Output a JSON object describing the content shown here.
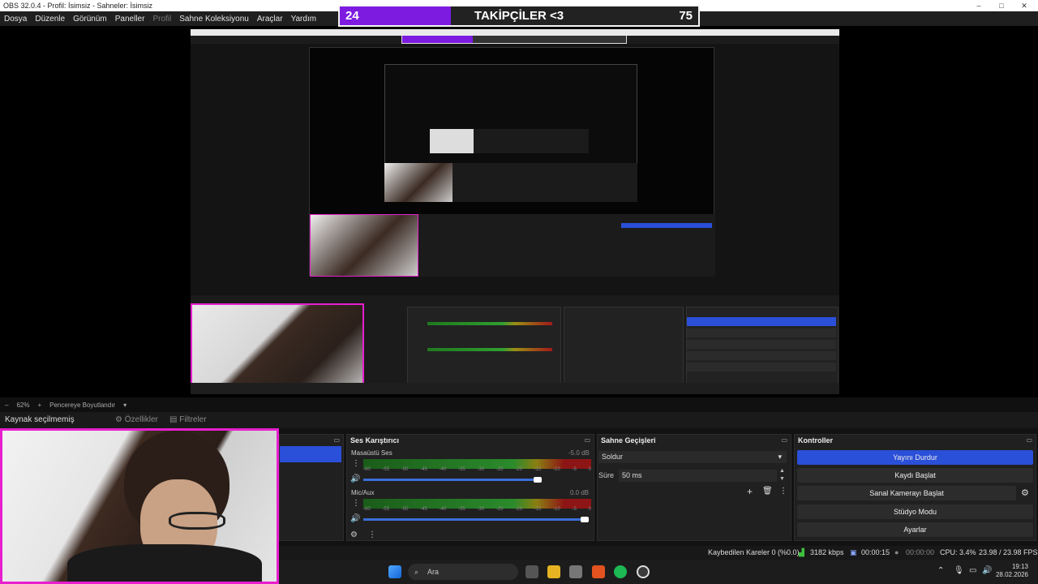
{
  "window": {
    "title": "OBS 32.0.4 - Profil: İsimsiz - Sahneler: İsimsiz",
    "controls": [
      "–",
      "□",
      "✕"
    ]
  },
  "menu": [
    "Dosya",
    "Düzenle",
    "Görünüm",
    "Paneller",
    "Profil",
    "Sahne Koleksiyonu",
    "Araçlar",
    "Yardım"
  ],
  "followers_bar": {
    "current": "24",
    "label": "TAKİPÇİLER <3",
    "goal": "75",
    "fill_color": "#7d1be0"
  },
  "preview_bar": {
    "zoom": "62%",
    "minus": "–",
    "plus": "+",
    "fit_label": "Pencereye Boyutlandır"
  },
  "source_bar": {
    "status": "Kaynak seçilmemiş",
    "properties": "Özellikler",
    "filters": "Filtreler"
  },
  "audio_mixer": {
    "title": "Ses Karıştırıcı",
    "channels": [
      {
        "name": "Masaüstü Ses",
        "db": "-5.0 dB"
      },
      {
        "name": "Mic/Aux",
        "db": "0.0 dB"
      }
    ],
    "ticks": [
      "-60",
      "-55",
      "-50",
      "-45",
      "-40",
      "-35",
      "-30",
      "-25",
      "-20",
      "-15",
      "-10",
      "-5",
      "0"
    ]
  },
  "scene_transitions": {
    "title": "Sahne Geçişleri",
    "transition": "Soldur",
    "duration_label": "Süre",
    "duration_value": "50 ms"
  },
  "controls": {
    "title": "Kontroller",
    "buttons": [
      "Yayını Durdur",
      "Kaydı Başlat",
      "Sanal Kamerayı Başlat",
      "Stüdyo Modu",
      "Ayarlar"
    ]
  },
  "status_bar": {
    "dropped": "Kaybedilen Kareler 0 (%0.0)",
    "bitrate": "3182 kbps",
    "stream_time": "00:00:15",
    "rec_time": "00:00:00",
    "cpu": "CPU: 3.4%",
    "fps": "23.98 / 23.98 FPS"
  },
  "taskbar": {
    "search_placeholder": "Ara",
    "time": "19:13",
    "date": "28.02.2026"
  },
  "colors": {
    "accent_blue": "#2a4fd8",
    "webcam_border": "#e81ecf"
  }
}
